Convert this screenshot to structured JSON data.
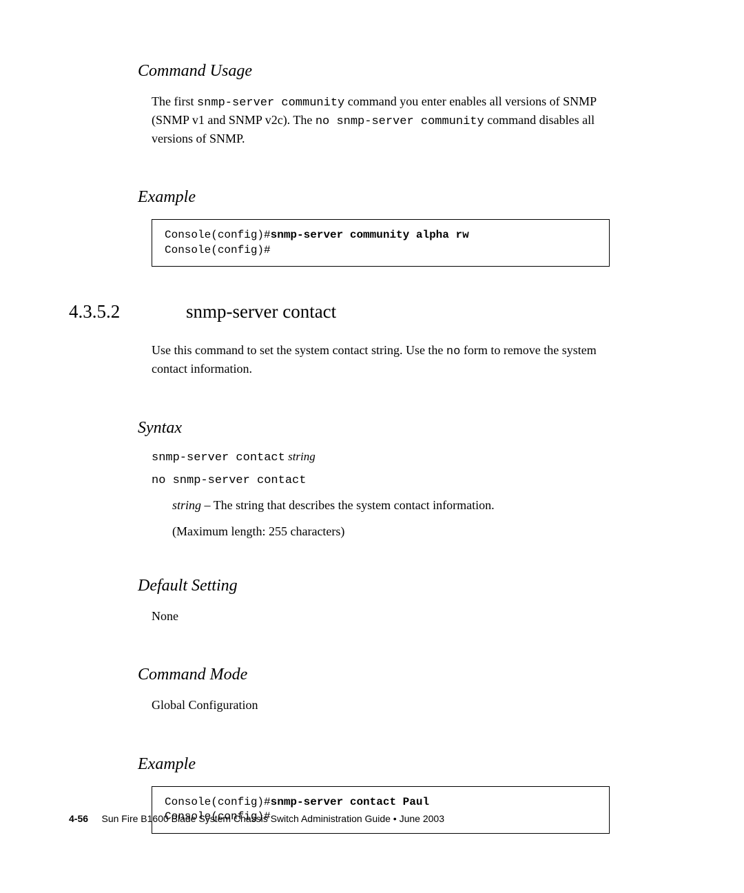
{
  "section1": {
    "heading": "Command Usage",
    "para_part1": "The first ",
    "para_cmd1": "snmp-server community",
    "para_part2": " command you enter enables all versions of SNMP (SNMP v1 and SNMP v2c). The ",
    "para_cmd2": "no snmp-server community",
    "para_part3": " command disables all versions of SNMP."
  },
  "example1": {
    "heading": "Example",
    "prompt1": "Console(config)#",
    "bold_cmd": "snmp-server community alpha rw",
    "prompt2": "Console(config)#"
  },
  "section2": {
    "number": "4.3.5.2",
    "title": "snmp-server contact",
    "para_part1": "Use this command to set the system contact string. Use the ",
    "para_cmd": "no",
    "para_part2": " form to remove the system contact information."
  },
  "syntax": {
    "heading": "Syntax",
    "line1_cmd": "snmp-server contact",
    "line1_arg": " string",
    "line2": "no snmp-server contact",
    "param_arg": "string",
    "param_desc": " – The string that describes the system contact information.",
    "param_note": "(Maximum length: 255 characters)"
  },
  "default_setting": {
    "heading": "Default Setting",
    "value": "None"
  },
  "command_mode": {
    "heading": "Command Mode",
    "value": "Global Configuration"
  },
  "example2": {
    "heading": "Example",
    "prompt1": "Console(config)#",
    "bold_cmd": "snmp-server contact Paul",
    "prompt2": "Console(config)#"
  },
  "footer": {
    "page_number": "4-56",
    "guide_title": "Sun Fire B1600 Blade System Chassis Switch Administration Guide • June 2003"
  }
}
